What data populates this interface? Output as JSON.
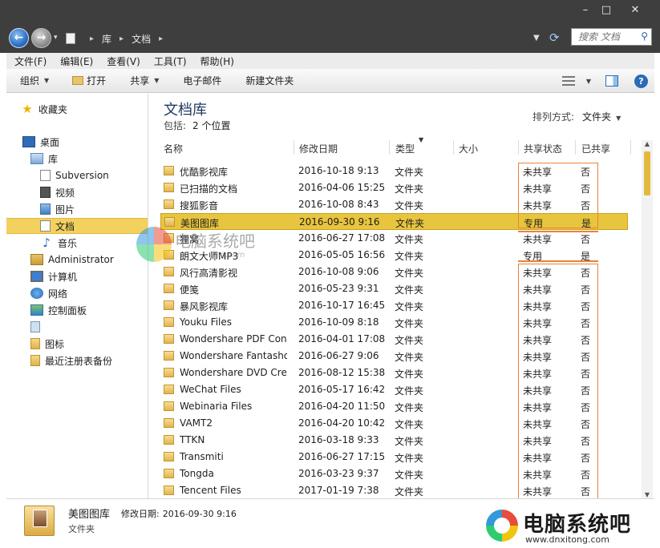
{
  "titlebar": {
    "minimize": "–",
    "maximize": "□",
    "close": "✕"
  },
  "address": {
    "breadcrumb": [
      "库",
      "文档"
    ],
    "search_placeholder": "搜索 文档"
  },
  "menu": [
    "文件(F)",
    "编辑(E)",
    "查看(V)",
    "工具(T)",
    "帮助(H)"
  ],
  "toolbar": {
    "organize": "组织",
    "open": "打开",
    "share": "共享",
    "email": "电子邮件",
    "new_folder": "新建文件夹"
  },
  "nav": {
    "favorites": "收藏夹",
    "desktop": "桌面",
    "libraries": "库",
    "subversion": "Subversion",
    "videos": "视频",
    "pictures": "图片",
    "documents": "文档",
    "music": "音乐",
    "administrator": "Administrator",
    "computer": "计算机",
    "network": "网络",
    "control_panel": "控制面板",
    "icons": "图标",
    "registry_backup": "最近注册表备份"
  },
  "library": {
    "title": "文档库",
    "includes_label": "包括:",
    "includes_value": "2 个位置",
    "arrange_label": "排列方式:",
    "arrange_value": "文件夹"
  },
  "columns": {
    "name": "名称",
    "modified": "修改日期",
    "type": "类型",
    "size": "大小",
    "share_state": "共享状态",
    "shared": "已共享"
  },
  "files": [
    {
      "name": "优酷影视库",
      "date": "2016-10-18 9:13",
      "type": "文件夹",
      "share": "未共享",
      "shared": "否"
    },
    {
      "name": "已扫描的文档",
      "date": "2016-04-06 15:25",
      "type": "文件夹",
      "share": "未共享",
      "shared": "否"
    },
    {
      "name": "搜狐影音",
      "date": "2016-10-08 8:43",
      "type": "文件夹",
      "share": "未共享",
      "shared": "否"
    },
    {
      "name": "美图图库",
      "date": "2016-09-30 9:16",
      "type": "文件夹",
      "share": "专用",
      "shared": "是"
    },
    {
      "name": "狸窝",
      "date": "2016-06-27 17:08",
      "type": "文件夹",
      "share": "未共享",
      "shared": "否"
    },
    {
      "name": "朗文大师MP3",
      "date": "2016-05-05 16:56",
      "type": "文件夹",
      "share": "专用",
      "shared": "是"
    },
    {
      "name": "风行高清影视",
      "date": "2016-10-08 9:06",
      "type": "文件夹",
      "share": "未共享",
      "shared": "否"
    },
    {
      "name": "便笺",
      "date": "2016-05-23 9:31",
      "type": "文件夹",
      "share": "未共享",
      "shared": "否"
    },
    {
      "name": "暴风影视库",
      "date": "2016-10-17 16:45",
      "type": "文件夹",
      "share": "未共享",
      "shared": "否"
    },
    {
      "name": "Youku Files",
      "date": "2016-10-09 8:18",
      "type": "文件夹",
      "share": "未共享",
      "shared": "否"
    },
    {
      "name": "Wondershare PDF Conv...",
      "date": "2016-04-01 17:08",
      "type": "文件夹",
      "share": "未共享",
      "shared": "否"
    },
    {
      "name": "Wondershare Fantasho...",
      "date": "2016-06-27 9:06",
      "type": "文件夹",
      "share": "未共享",
      "shared": "否"
    },
    {
      "name": "Wondershare DVD Crea...",
      "date": "2016-08-12 15:38",
      "type": "文件夹",
      "share": "未共享",
      "shared": "否"
    },
    {
      "name": "WeChat Files",
      "date": "2016-05-17 16:42",
      "type": "文件夹",
      "share": "未共享",
      "shared": "否"
    },
    {
      "name": "Webinaria Files",
      "date": "2016-04-20 11:50",
      "type": "文件夹",
      "share": "未共享",
      "shared": "否"
    },
    {
      "name": "VAMT2",
      "date": "2016-04-20 10:42",
      "type": "文件夹",
      "share": "未共享",
      "shared": "否"
    },
    {
      "name": "TTKN",
      "date": "2016-03-18 9:33",
      "type": "文件夹",
      "share": "未共享",
      "shared": "否"
    },
    {
      "name": "Transmiti",
      "date": "2016-06-27 17:15",
      "type": "文件夹",
      "share": "未共享",
      "shared": "否"
    },
    {
      "name": "Tongda",
      "date": "2016-03-23 9:37",
      "type": "文件夹",
      "share": "未共享",
      "shared": "否"
    },
    {
      "name": "Tencent Files",
      "date": "2017-01-19 7:38",
      "type": "文件夹",
      "share": "未共享",
      "shared": "否"
    }
  ],
  "selected_index": 3,
  "details": {
    "name": "美图图库",
    "modified_label": "修改日期:",
    "modified_value": "2016-09-30 9:16",
    "type": "文件夹"
  },
  "watermark": {
    "brand": "电脑系统吧",
    "url": "www.dnxitong.com",
    "url_partial": "ong.com"
  },
  "colors": {
    "chrome": "#3e3e3e",
    "selection": "#e8c53e",
    "highlight": "#e8833a"
  }
}
